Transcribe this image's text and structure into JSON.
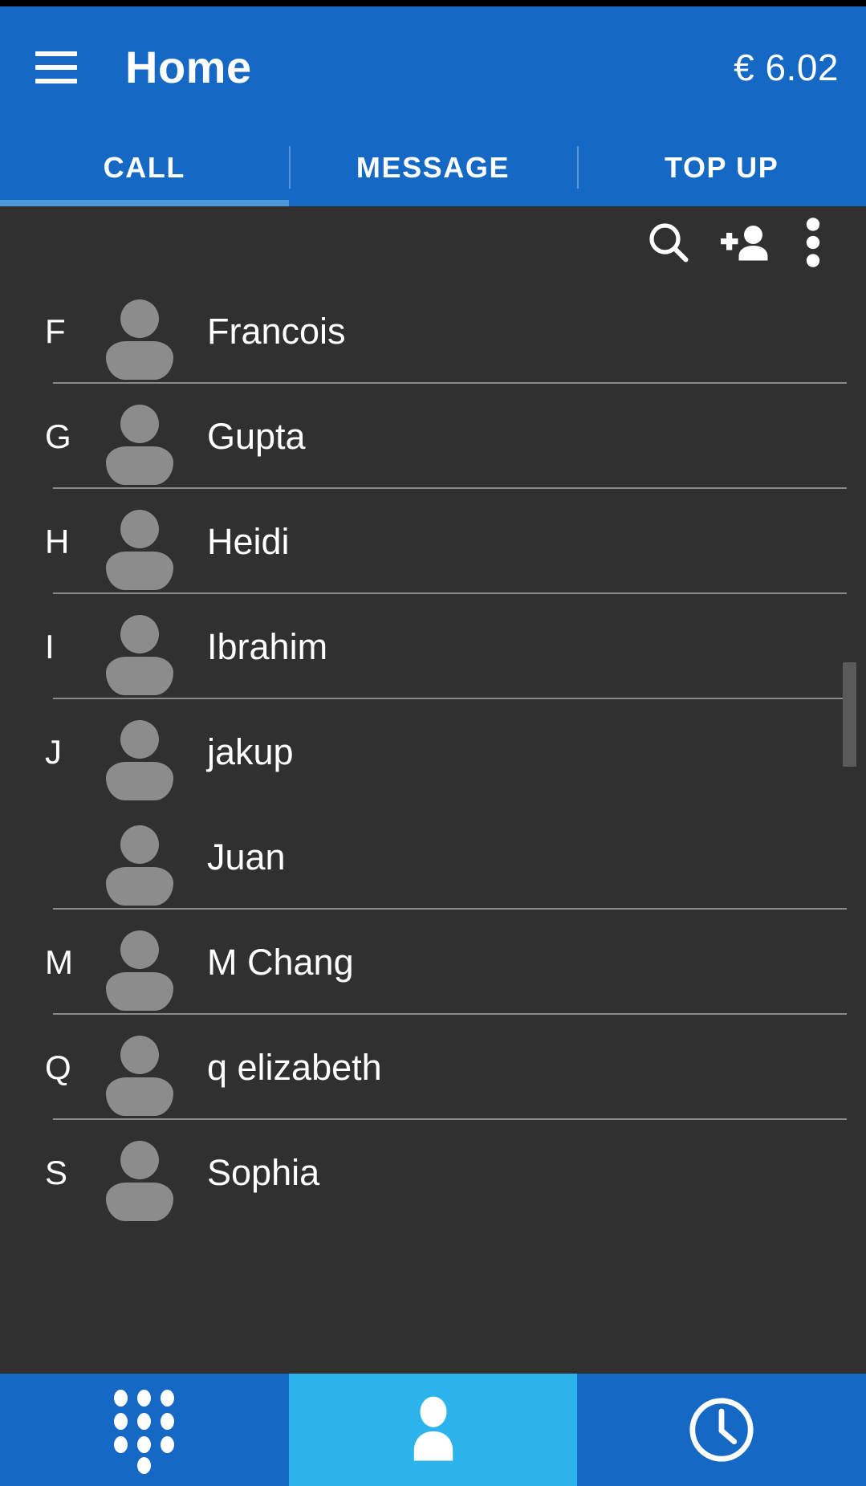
{
  "colors": {
    "header_blue": "#1568c4",
    "tab_indicator": "#4e97da",
    "content_bg": "#303030",
    "nav_active": "#2cb3ec",
    "avatar_gray": "#8c8c8c",
    "divider": "#8a8a8a"
  },
  "appbar": {
    "menu_icon": "hamburger-menu-icon",
    "title": "Home",
    "balance": "€ 6.02"
  },
  "tabs": {
    "items": [
      {
        "label": "CALL",
        "active": true
      },
      {
        "label": "MESSAGE",
        "active": false
      },
      {
        "label": "TOP UP",
        "active": false
      }
    ]
  },
  "actions": [
    {
      "name": "search-icon",
      "label": "Search"
    },
    {
      "name": "add-contact-icon",
      "label": "Add contact"
    },
    {
      "name": "overflow-menu-icon",
      "label": "More options"
    }
  ],
  "contacts": [
    {
      "section": "F",
      "name": "Francois",
      "divider": true
    },
    {
      "section": "G",
      "name": "Gupta",
      "divider": true
    },
    {
      "section": "H",
      "name": "Heidi",
      "divider": true
    },
    {
      "section": "I",
      "name": "Ibrahim",
      "divider": true
    },
    {
      "section": "J",
      "name": "jakup",
      "divider": false
    },
    {
      "section": "",
      "name": "Juan",
      "divider": true
    },
    {
      "section": "M",
      "name": "M Chang",
      "divider": true
    },
    {
      "section": "Q",
      "name": "q elizabeth",
      "divider": true
    },
    {
      "section": "S",
      "name": "Sophia",
      "divider": false
    }
  ],
  "bottom_nav": [
    {
      "name": "dialpad-icon",
      "label": "Dialpad",
      "active": false
    },
    {
      "name": "contacts-icon",
      "label": "Contacts",
      "active": true
    },
    {
      "name": "recents-clock-icon",
      "label": "Recents",
      "active": false
    }
  ]
}
